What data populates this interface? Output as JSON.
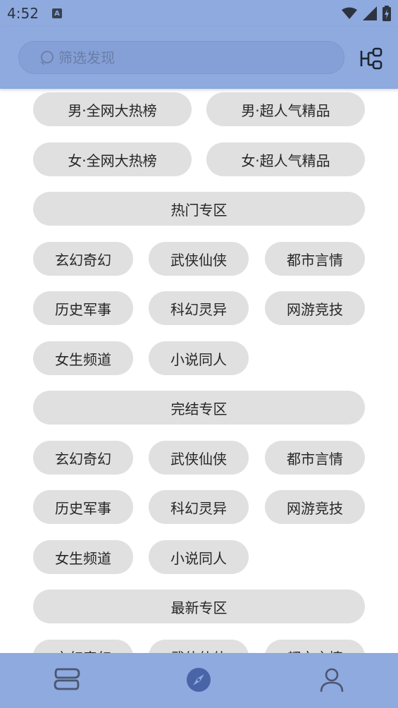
{
  "status": {
    "time": "4:52",
    "badge": "A"
  },
  "search": {
    "placeholder": "筛选发现",
    "value": ""
  },
  "rows": [
    [
      "男·全网大热榜",
      "男·超人气精品"
    ],
    [
      "女·全网大热榜",
      "女·超人气精品"
    ],
    [
      "热门专区"
    ],
    [
      "玄幻奇幻",
      "武侠仙侠",
      "都市言情"
    ],
    [
      "历史军事",
      "科幻灵异",
      "网游竞技"
    ],
    [
      "女生频道",
      "小说同人"
    ],
    [
      "完结专区"
    ],
    [
      "玄幻奇幻",
      "武侠仙侠",
      "都市言情"
    ],
    [
      "历史军事",
      "科幻灵异",
      "网游竞技"
    ],
    [
      "女生频道",
      "小说同人"
    ],
    [
      "最新专区"
    ],
    [
      "玄幻奇幻",
      "武侠仙侠",
      "都市言情"
    ]
  ],
  "nav": {
    "items": [
      "bookshelf-icon",
      "explore-icon",
      "profile-icon"
    ],
    "active": 1
  },
  "colors": {
    "accent": "#8eaadf",
    "chip": "#e0e0e0",
    "active_icon": "#4a64a8"
  }
}
